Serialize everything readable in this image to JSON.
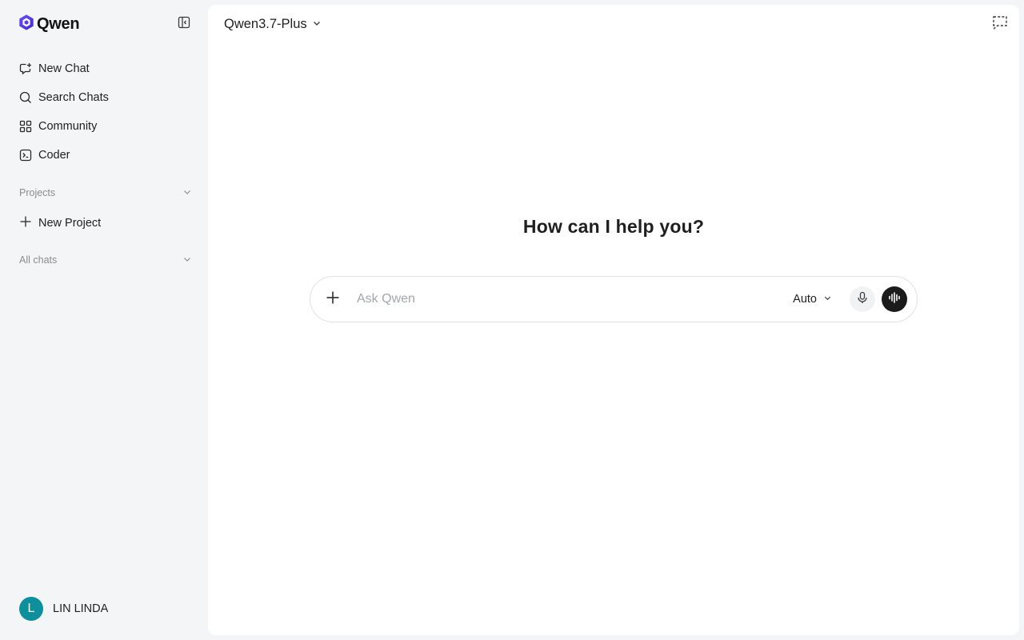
{
  "sidebar": {
    "brand": "Qwen",
    "nav": [
      {
        "label": "New Chat",
        "icon": "new-chat-icon"
      },
      {
        "label": "Search Chats",
        "icon": "search-icon"
      },
      {
        "label": "Community",
        "icon": "grid-icon"
      },
      {
        "label": "Coder",
        "icon": "terminal-icon"
      }
    ],
    "projects_label": "Projects",
    "new_project_label": "New Project",
    "all_chats_label": "All chats",
    "user": {
      "initial": "L",
      "name": "LIN LINDA"
    }
  },
  "header": {
    "model_name": "Qwen3.7-Plus"
  },
  "main": {
    "greeting": "How can I help you?",
    "composer": {
      "placeholder": "Ask Qwen",
      "mode": "Auto"
    }
  },
  "colors": {
    "brand": "#5b3cf0",
    "avatar": "#0e8f9c",
    "voice_button": "#1b1b1b",
    "sidebar_bg": "#f4f5f7"
  }
}
